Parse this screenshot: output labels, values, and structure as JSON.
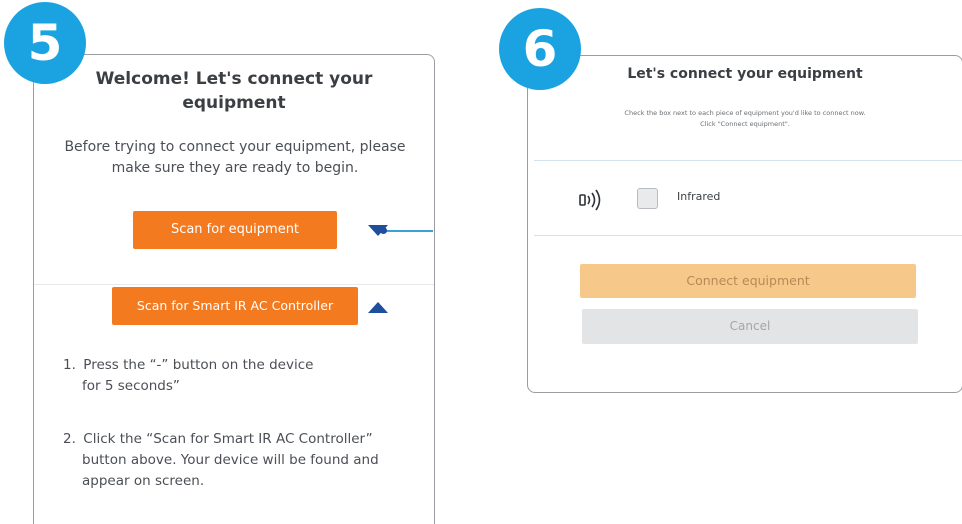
{
  "step5": {
    "badge": "5",
    "title": "Welcome! Let's connect your equipment",
    "intro": "Before trying to connect your equipment, please make sure they are ready to begin.",
    "scan_button": "Scan for equipment",
    "scan_ir_button": "Scan for Smart IR AC Controller",
    "instructions": [
      {
        "num": "1.",
        "first": "Press the “-” button on the device",
        "rest": "for 5 seconds”"
      },
      {
        "num": "2.",
        "first": "Click the “Scan for Smart IR AC Controller”",
        "rest": "button above.  Your device will be found and appear on screen."
      }
    ]
  },
  "step6": {
    "badge": "6",
    "title": "Let's connect your equipment",
    "note_line1": "Check the box next to each piece of equipment you'd like to connect now.",
    "note_line2": "Click \"Connect equipment\".",
    "equipment": [
      {
        "label": "Infrared",
        "icon": "infrared-signal-icon",
        "checked": false
      }
    ],
    "connect_button": "Connect equipment",
    "cancel_button": "Cancel"
  },
  "colors": {
    "badge": "#1aa3e0",
    "orange": "#f47a1f",
    "connect_disabled": "#f6c98a",
    "cancel": "#e3e4e5",
    "arrow": "#1f4e9c"
  }
}
